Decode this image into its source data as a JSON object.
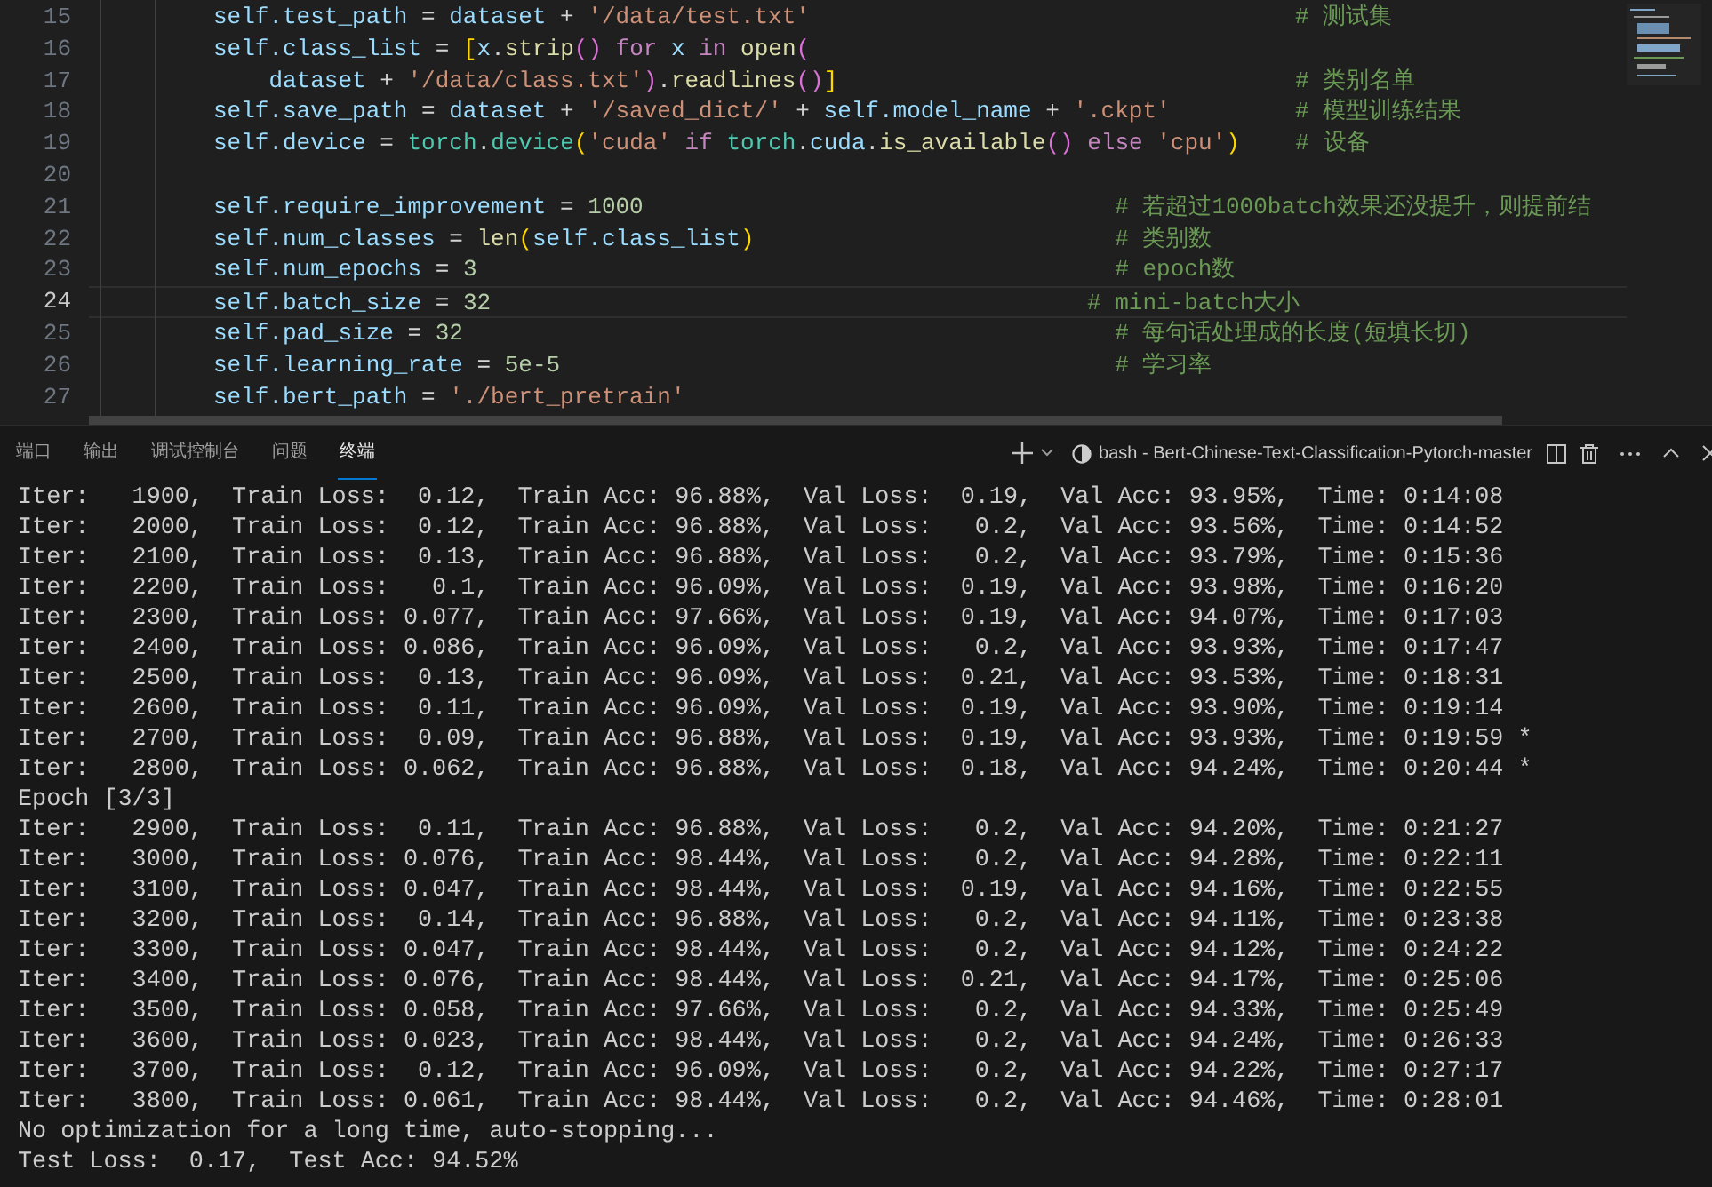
{
  "editor": {
    "lines": [
      {
        "number": "15",
        "current": false,
        "tokens": [
          {
            "kind": "var",
            "text": "self.test_path"
          },
          {
            "kind": "plain",
            "text": " = "
          },
          {
            "kind": "var",
            "text": "dataset"
          },
          {
            "kind": "plain",
            "text": " + "
          },
          {
            "kind": "string",
            "text": "'/data/test.txt'"
          },
          {
            "kind": "comment",
            "text": "                                   # 测试集"
          }
        ]
      },
      {
        "number": "16",
        "current": false,
        "tokens": [
          {
            "kind": "var",
            "text": "self.class_list"
          },
          {
            "kind": "plain",
            "text": " = "
          },
          {
            "kind": "bracket1",
            "text": "["
          },
          {
            "kind": "var",
            "text": "x"
          },
          {
            "kind": "plain",
            "text": "."
          },
          {
            "kind": "func",
            "text": "strip"
          },
          {
            "kind": "bracket2",
            "text": "()"
          },
          {
            "kind": "keyword",
            "text": " for "
          },
          {
            "kind": "var",
            "text": "x"
          },
          {
            "kind": "keyword",
            "text": " in "
          },
          {
            "kind": "func",
            "text": "open"
          },
          {
            "kind": "bracket2",
            "text": "("
          }
        ]
      },
      {
        "number": "17",
        "current": false,
        "tokens": [
          {
            "kind": "var",
            "text": "    dataset"
          },
          {
            "kind": "plain",
            "text": " + "
          },
          {
            "kind": "string",
            "text": "'/data/class.txt'"
          },
          {
            "kind": "bracket2",
            "text": ")"
          },
          {
            "kind": "plain",
            "text": "."
          },
          {
            "kind": "func",
            "text": "readlines"
          },
          {
            "kind": "bracket2",
            "text": "()"
          },
          {
            "kind": "bracket1",
            "text": "]"
          },
          {
            "kind": "comment",
            "text": "                                 # 类别名单"
          }
        ]
      },
      {
        "number": "18",
        "current": false,
        "tokens": [
          {
            "kind": "var",
            "text": "self.save_path"
          },
          {
            "kind": "plain",
            "text": " = "
          },
          {
            "kind": "var",
            "text": "dataset"
          },
          {
            "kind": "plain",
            "text": " + "
          },
          {
            "kind": "string",
            "text": "'/saved_dict/'"
          },
          {
            "kind": "plain",
            "text": " + "
          },
          {
            "kind": "var",
            "text": "self.model_name"
          },
          {
            "kind": "plain",
            "text": " + "
          },
          {
            "kind": "string",
            "text": "'.ckpt'"
          },
          {
            "kind": "comment",
            "text": "         # 模型训练结果"
          }
        ]
      },
      {
        "number": "19",
        "current": false,
        "tokens": [
          {
            "kind": "var",
            "text": "self.device"
          },
          {
            "kind": "plain",
            "text": " = "
          },
          {
            "kind": "module",
            "text": "torch"
          },
          {
            "kind": "plain",
            "text": "."
          },
          {
            "kind": "module",
            "text": "device"
          },
          {
            "kind": "bracket1",
            "text": "("
          },
          {
            "kind": "string",
            "text": "'cuda'"
          },
          {
            "kind": "keyword",
            "text": " if "
          },
          {
            "kind": "module",
            "text": "torch"
          },
          {
            "kind": "plain",
            "text": "."
          },
          {
            "kind": "var",
            "text": "cuda"
          },
          {
            "kind": "plain",
            "text": "."
          },
          {
            "kind": "func",
            "text": "is_available"
          },
          {
            "kind": "bracket2",
            "text": "()"
          },
          {
            "kind": "keyword",
            "text": " else "
          },
          {
            "kind": "string",
            "text": "'cpu'"
          },
          {
            "kind": "bracket1",
            "text": ")"
          },
          {
            "kind": "comment",
            "text": "    # 设备"
          }
        ]
      },
      {
        "number": "20",
        "current": false
      },
      {
        "number": "21",
        "current": false,
        "tokens": [
          {
            "kind": "var",
            "text": "self.require_improvement"
          },
          {
            "kind": "plain",
            "text": " = "
          },
          {
            "kind": "number",
            "text": "1000"
          },
          {
            "kind": "comment",
            "text": "                                  # 若超过1000batch效果还没提升，则提前结"
          }
        ]
      },
      {
        "number": "22",
        "current": false,
        "tokens": [
          {
            "kind": "var",
            "text": "self.num_classes"
          },
          {
            "kind": "plain",
            "text": " = "
          },
          {
            "kind": "func",
            "text": "len"
          },
          {
            "kind": "bracket1",
            "text": "("
          },
          {
            "kind": "var",
            "text": "self.class_list"
          },
          {
            "kind": "bracket1",
            "text": ")"
          },
          {
            "kind": "comment",
            "text": "                          # 类别数"
          }
        ]
      },
      {
        "number": "23",
        "current": false,
        "tokens": [
          {
            "kind": "var",
            "text": "self.num_epochs"
          },
          {
            "kind": "plain",
            "text": " = "
          },
          {
            "kind": "number",
            "text": "3"
          },
          {
            "kind": "comment",
            "text": "                                              # epoch数"
          }
        ]
      },
      {
        "number": "24",
        "current": true,
        "tokens": [
          {
            "kind": "var",
            "text": "self.batch_size"
          },
          {
            "kind": "plain",
            "text": " = "
          },
          {
            "kind": "number",
            "text": "32"
          },
          {
            "kind": "comment",
            "text": "                                           # mini-batch大小"
          }
        ]
      },
      {
        "number": "25",
        "current": false,
        "tokens": [
          {
            "kind": "var",
            "text": "self.pad_size"
          },
          {
            "kind": "plain",
            "text": " = "
          },
          {
            "kind": "number",
            "text": "32"
          },
          {
            "kind": "comment",
            "text": "                                               # 每句话处理成的长度(短填长切)"
          }
        ]
      },
      {
        "number": "26",
        "current": false,
        "tokens": [
          {
            "kind": "var",
            "text": "self.learning_rate"
          },
          {
            "kind": "plain",
            "text": " = "
          },
          {
            "kind": "number",
            "text": "5e-5"
          },
          {
            "kind": "comment",
            "text": "                                        # 学习率"
          }
        ]
      },
      {
        "number": "27",
        "current": false,
        "tokens": [
          {
            "kind": "var",
            "text": "self.bert_path"
          },
          {
            "kind": "plain",
            "text": " = "
          },
          {
            "kind": "string",
            "text": "'./bert_pretrain'"
          }
        ]
      }
    ]
  },
  "panel": {
    "tabs": [
      {
        "label": "端口",
        "selected": false
      },
      {
        "label": "输出",
        "selected": false
      },
      {
        "label": "调试控制台",
        "selected": false
      },
      {
        "label": "问题",
        "selected": false
      },
      {
        "label": "终端",
        "selected": true
      }
    ],
    "terminal_name": "bash - Bert-Chinese-Text-Classification-Pytorch-master"
  },
  "terminal": {
    "lines": [
      "Iter:   1900,  Train Loss:  0.12,  Train Acc: 96.88%,  Val Loss:  0.19,  Val Acc: 93.95%,  Time: 0:14:08",
      "Iter:   2000,  Train Loss:  0.12,  Train Acc: 96.88%,  Val Loss:   0.2,  Val Acc: 93.56%,  Time: 0:14:52",
      "Iter:   2100,  Train Loss:  0.13,  Train Acc: 96.88%,  Val Loss:   0.2,  Val Acc: 93.79%,  Time: 0:15:36",
      "Iter:   2200,  Train Loss:   0.1,  Train Acc: 96.09%,  Val Loss:  0.19,  Val Acc: 93.98%,  Time: 0:16:20",
      "Iter:   2300,  Train Loss: 0.077,  Train Acc: 97.66%,  Val Loss:  0.19,  Val Acc: 94.07%,  Time: 0:17:03",
      "Iter:   2400,  Train Loss: 0.086,  Train Acc: 96.09%,  Val Loss:   0.2,  Val Acc: 93.93%,  Time: 0:17:47",
      "Iter:   2500,  Train Loss:  0.13,  Train Acc: 96.09%,  Val Loss:  0.21,  Val Acc: 93.53%,  Time: 0:18:31",
      "Iter:   2600,  Train Loss:  0.11,  Train Acc: 96.09%,  Val Loss:  0.19,  Val Acc: 93.90%,  Time: 0:19:14",
      "Iter:   2700,  Train Loss:  0.09,  Train Acc: 96.88%,  Val Loss:  0.19,  Val Acc: 93.93%,  Time: 0:19:59 *",
      "Iter:   2800,  Train Loss: 0.062,  Train Acc: 96.88%,  Val Loss:  0.18,  Val Acc: 94.24%,  Time: 0:20:44 *",
      "Epoch [3/3]",
      "Iter:   2900,  Train Loss:  0.11,  Train Acc: 96.88%,  Val Loss:   0.2,  Val Acc: 94.20%,  Time: 0:21:27",
      "Iter:   3000,  Train Loss: 0.076,  Train Acc: 98.44%,  Val Loss:   0.2,  Val Acc: 94.28%,  Time: 0:22:11",
      "Iter:   3100,  Train Loss: 0.047,  Train Acc: 98.44%,  Val Loss:  0.19,  Val Acc: 94.16%,  Time: 0:22:55",
      "Iter:   3200,  Train Loss:  0.14,  Train Acc: 96.88%,  Val Loss:   0.2,  Val Acc: 94.11%,  Time: 0:23:38",
      "Iter:   3300,  Train Loss: 0.047,  Train Acc: 98.44%,  Val Loss:   0.2,  Val Acc: 94.12%,  Time: 0:24:22",
      "Iter:   3400,  Train Loss: 0.076,  Train Acc: 98.44%,  Val Loss:  0.21,  Val Acc: 94.17%,  Time: 0:25:06",
      "Iter:   3500,  Train Loss: 0.058,  Train Acc: 97.66%,  Val Loss:   0.2,  Val Acc: 94.33%,  Time: 0:25:49",
      "Iter:   3600,  Train Loss: 0.023,  Train Acc: 98.44%,  Val Loss:   0.2,  Val Acc: 94.24%,  Time: 0:26:33",
      "Iter:   3700,  Train Loss:  0.12,  Train Acc: 96.09%,  Val Loss:   0.2,  Val Acc: 94.22%,  Time: 0:27:17",
      "Iter:   3800,  Train Loss: 0.061,  Train Acc: 98.44%,  Val Loss:   0.2,  Val Acc: 94.46%,  Time: 0:28:01",
      "No optimization for a long time, auto-stopping...",
      "Test Loss:  0.17,  Test Acc: 94.52%"
    ]
  }
}
